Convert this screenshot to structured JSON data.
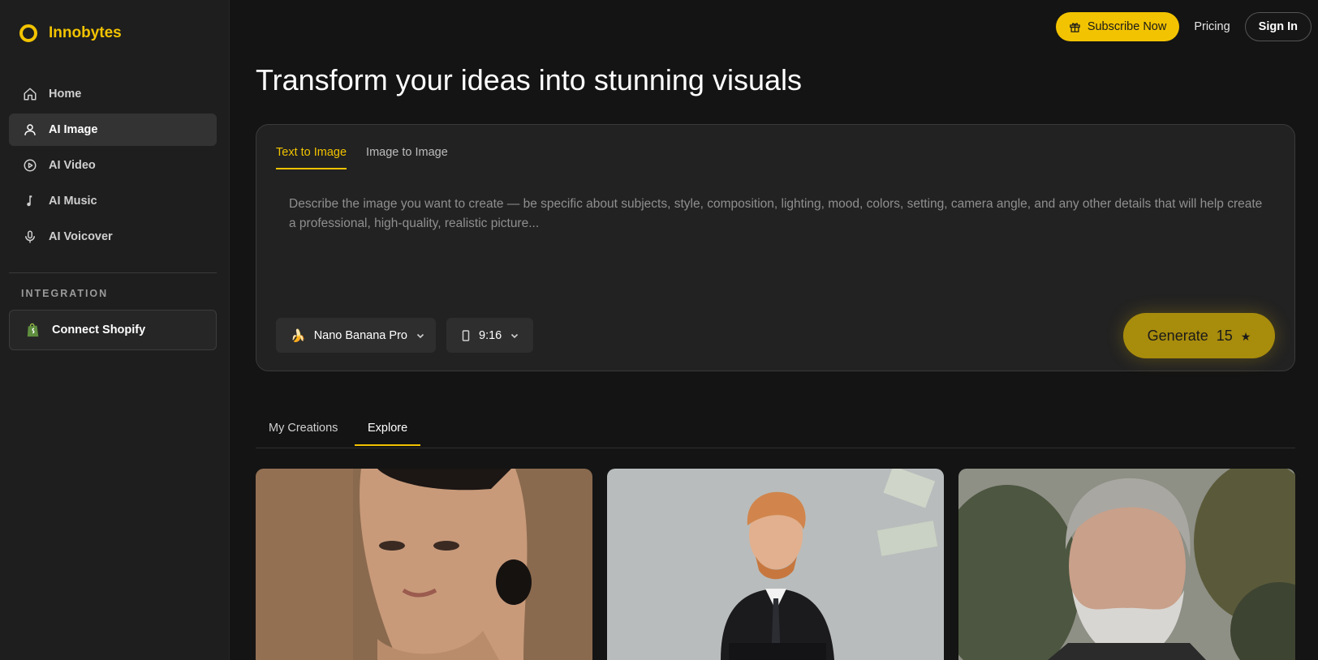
{
  "brand": {
    "name": "Innobytes",
    "accent": "#f2c300"
  },
  "sidebar": {
    "items": [
      {
        "label": "Home",
        "icon": "home-icon"
      },
      {
        "label": "AI Image",
        "icon": "user-icon",
        "active": true
      },
      {
        "label": "AI Video",
        "icon": "play-circle-icon"
      },
      {
        "label": "AI Music",
        "icon": "music-note-icon"
      },
      {
        "label": "AI Voicover",
        "icon": "microphone-icon"
      }
    ],
    "section_label": "INTEGRATION",
    "integration": {
      "label": "Connect Shopify",
      "icon": "shopify-icon"
    }
  },
  "topbar": {
    "subscribe_label": "Subscribe Now",
    "pricing_label": "Pricing",
    "signin_label": "Sign In"
  },
  "main": {
    "headline": "Transform your ideas into stunning visuals",
    "tabs": [
      {
        "label": "Text to Image",
        "active": true
      },
      {
        "label": "Image to Image",
        "active": false
      }
    ],
    "prompt_placeholder": "Describe the image you want to create — be specific about subjects, style, composition, lighting, mood, colors, setting, camera angle, and any other details that will help create a professional, high-quality, realistic picture...",
    "model_select": {
      "value": "Nano Banana Pro",
      "icon": "banana-icon"
    },
    "ratio_select": {
      "value": "9:16",
      "icon": "portrait-frame-icon"
    },
    "generate": {
      "label": "Generate",
      "credits": "15",
      "icon": "star-icon"
    }
  },
  "gallery": {
    "tabs": [
      {
        "label": "My Creations",
        "active": false
      },
      {
        "label": "Explore",
        "active": true
      }
    ],
    "items": [
      {
        "subject": "woman portrait",
        "bg": "#8a6a4e"
      },
      {
        "subject": "man in suit with flying money",
        "bg": "#b9bcbc"
      },
      {
        "subject": "older man outdoors",
        "bg": "#6c6f62"
      }
    ]
  }
}
